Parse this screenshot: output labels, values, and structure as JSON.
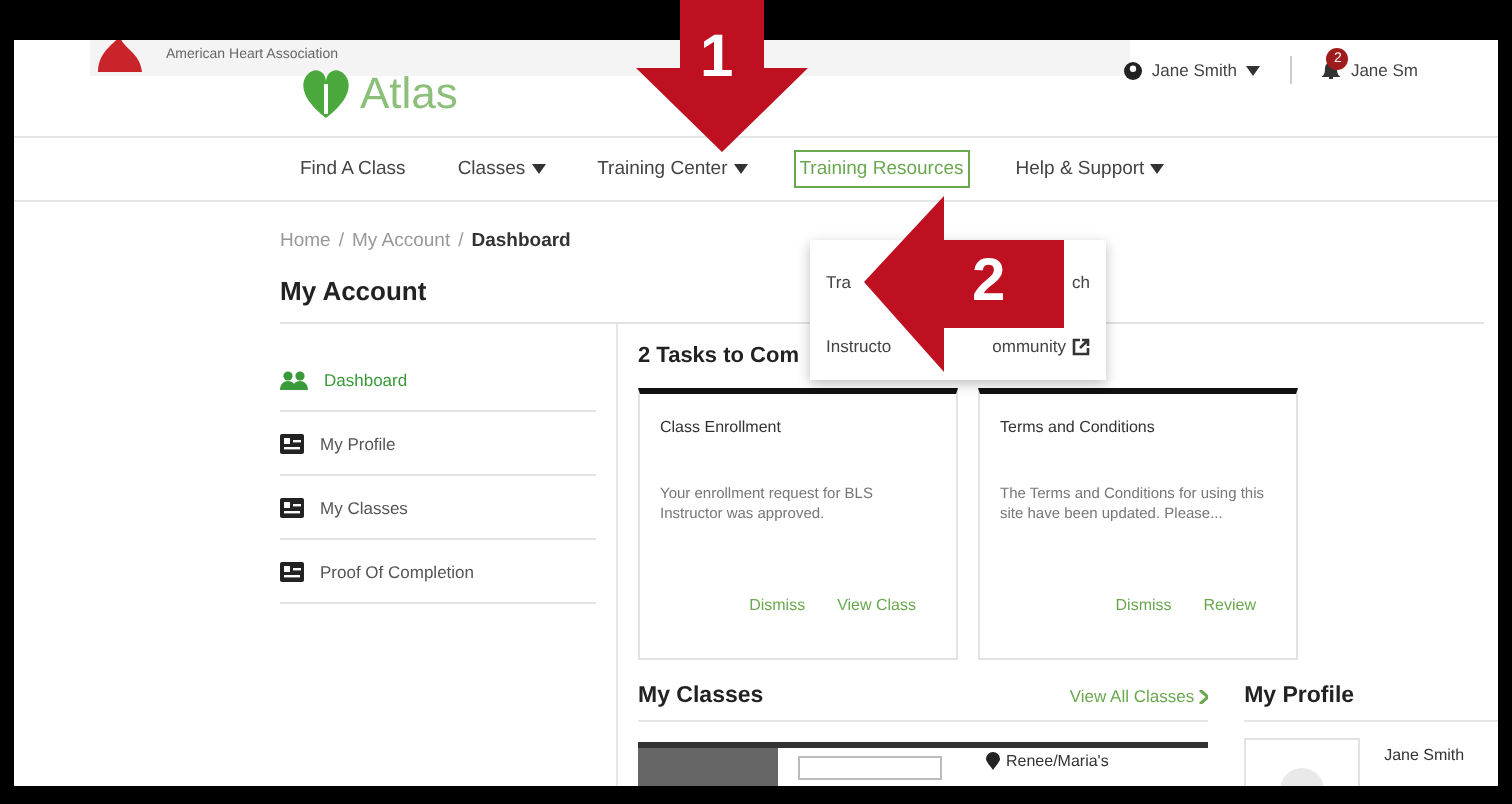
{
  "header": {
    "org_name": "American Heart Association",
    "logo_text": "Atlas",
    "user_name": "Jane Smith",
    "notification_count": "2",
    "second_user_name": "Jane Sm"
  },
  "nav": [
    {
      "label": "Find A Class",
      "dropdown": false,
      "selected": false
    },
    {
      "label": "Classes",
      "dropdown": true,
      "selected": false
    },
    {
      "label": "Training Center",
      "dropdown": true,
      "selected": false
    },
    {
      "label": "Training Resources",
      "dropdown": false,
      "selected": true
    },
    {
      "label": "Help & Support",
      "dropdown": true,
      "selected": false
    }
  ],
  "dropdown_menu": [
    {
      "kind": "covered",
      "parts": [
        "Tra",
        "ch"
      ]
    },
    {
      "kind": "covered_external",
      "parts": [
        "Instructo",
        "ommunity"
      ]
    }
  ],
  "breadcrumb": {
    "separator": "/",
    "items": [
      {
        "label": "Home",
        "current": false
      },
      {
        "label": "My Account",
        "current": false
      },
      {
        "label": "Dashboard",
        "current": true
      }
    ]
  },
  "page_title": "My Account",
  "sidebar": [
    {
      "label": "Dashboard",
      "selected": true
    },
    {
      "label": "My Profile",
      "selected": false
    },
    {
      "label": "My Classes",
      "selected": false
    },
    {
      "label": "Proof Of Completion",
      "selected": false
    }
  ],
  "tasks": {
    "title": "2 Tasks to Com",
    "cards": [
      {
        "title": "Class Enrollment",
        "body": "Your enrollment request for BLS Instructor was approved.",
        "actions": [
          "Dismiss",
          "View Class"
        ]
      },
      {
        "title": "Terms and Conditions",
        "body": "The Terms and Conditions for using this site have been updated. Please...",
        "actions": [
          "Dismiss",
          "Review"
        ]
      }
    ]
  },
  "my_classes": {
    "title": "My Classes",
    "link": "View All Classes",
    "location": "Renee/Maria's"
  },
  "my_profile": {
    "title": "My Profile",
    "name": "Jane Smith"
  },
  "annotations": [
    {
      "kind": "down",
      "number": "1"
    },
    {
      "kind": "left",
      "number": "2"
    }
  ]
}
